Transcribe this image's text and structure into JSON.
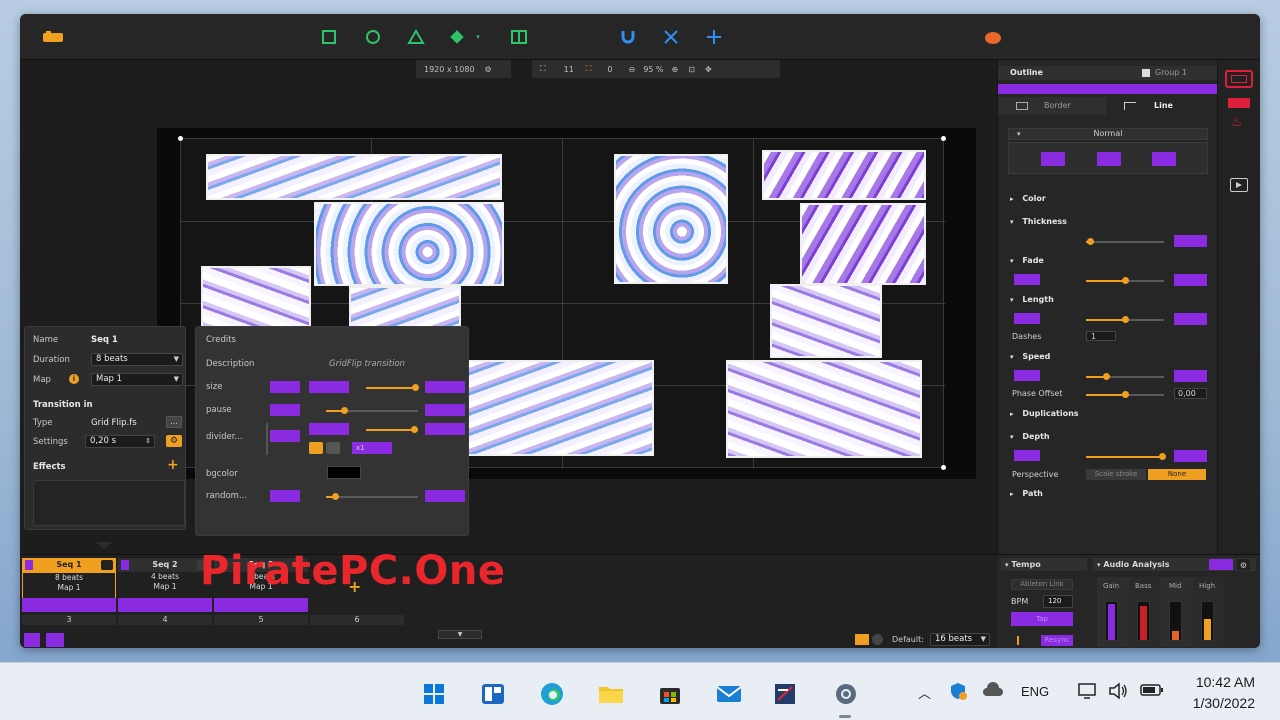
{
  "canvas_bar": {
    "resolution": "1920 x 1080",
    "count_a": "11",
    "count_b": "0",
    "zoom": "95 %"
  },
  "outline_panel": {
    "title": "Outline",
    "group_label": "Group 1",
    "tabs": [
      "Border",
      "Line"
    ],
    "blend_mode": "Normal",
    "sections": {
      "color": "Color",
      "thickness": "Thickness",
      "fade": "Fade",
      "length": "Length",
      "dashes_label": "Dashes",
      "dashes_value": "1",
      "speed": "Speed",
      "phase_label": "Phase Offset",
      "phase_value": "0,00",
      "duplications": "Duplications",
      "depth": "Depth",
      "perspective_label": "Perspective",
      "perspective_options": [
        "Scale stroke",
        "None"
      ],
      "path": "Path"
    },
    "slider_levels": {
      "thickness": 0.05,
      "fade": 0.5,
      "length": 0.5,
      "speed": 0.25,
      "phase": 0.5,
      "depth": 0.97
    }
  },
  "seq_props": {
    "name_label": "Name",
    "name_value": "Seq 1",
    "duration_label": "Duration",
    "duration_value": "8 beats",
    "map_label": "Map",
    "map_value": "Map 1",
    "transition_in": "Transition in",
    "type_label": "Type",
    "type_value": "Grid Flip.fs",
    "type_more": "...",
    "settings_label": "Settings",
    "settings_value": "0,20 s",
    "effects_label": "Effects",
    "effects_add": "+"
  },
  "credits_panel": {
    "credits_label": "Credits",
    "description_label": "Description",
    "description_value": "GridFlip transition",
    "params": [
      {
        "name": "size",
        "level": 0.95
      },
      {
        "name": "pause",
        "level": 0.2
      },
      {
        "name": "divider...",
        "level": 0.92
      },
      {
        "name": "bgcolor",
        "level": null
      },
      {
        "name": "random...",
        "level": 0.1
      }
    ],
    "divider_extra": "x1"
  },
  "timeline": {
    "sequences": [
      {
        "title": "Seq 1",
        "beats": "8 beats",
        "map": "Map 1"
      },
      {
        "title": "Seq 2",
        "beats": "4 beats",
        "map": "Map 1"
      },
      {
        "title": "Seq 3",
        "beats": "4 beats",
        "map": "Map 1"
      }
    ],
    "track_numbers": [
      "3",
      "4",
      "5",
      "6"
    ],
    "add_label": "+",
    "default_label": "Default:",
    "default_value": "16 beats"
  },
  "audio": {
    "tempo_title": "Tempo",
    "analysis_title": "Audio Analysis",
    "ableton_link": "Ableton Link",
    "bpm_label": "BPM",
    "bpm_value": "120",
    "tap_label": "Tap",
    "resync_label": "Resync",
    "meters": [
      {
        "name": "Gain",
        "level": 0.95
      },
      {
        "name": "Bass",
        "level": 0.9
      },
      {
        "name": "Mid",
        "level": 0.25
      },
      {
        "name": "High",
        "level": 0.55
      }
    ]
  },
  "watermark": "PiratePC.One",
  "taskbar": {
    "language": "ENG",
    "time": "10:42 AM",
    "date": "1/30/2022"
  },
  "colors": {
    "accent_purple": "#8a2be2",
    "accent_orange": "#f0a020",
    "tool_green": "#2fc46a",
    "tool_blue": "#2f8ff0",
    "watermark_red": "#e8262c"
  }
}
